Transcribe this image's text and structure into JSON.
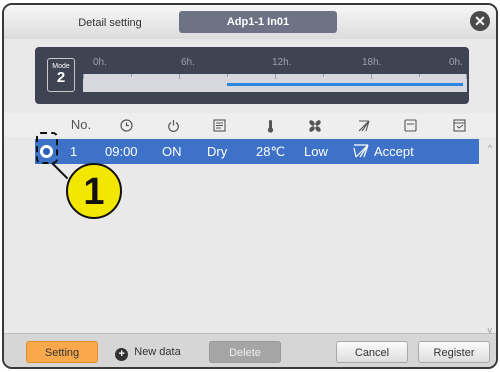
{
  "titlebar": {
    "tab_detail": "Detail setting",
    "tab_unit": "Adp1-1 In01"
  },
  "timeline": {
    "mode_label": "Mode",
    "mode_value": "2",
    "hours": [
      "0h.",
      "6h.",
      "12h.",
      "18h.",
      "0h."
    ],
    "run_start_hour": 9,
    "run_end_hour": 24,
    "run_color": "#2a86e3"
  },
  "headers": {
    "no": "No.",
    "icons": [
      "clock-icon",
      "power-icon",
      "mode-icon",
      "thermometer-icon",
      "fan-icon",
      "louver-icon",
      "filter-icon",
      "permission-icon"
    ]
  },
  "rows": [
    {
      "selected": true,
      "no": "1",
      "time": "09:00",
      "power": "ON",
      "mode": "Dry",
      "temp": "28℃",
      "fan": "Low",
      "louver_icon": "swing-icon",
      "permission": "Accept"
    }
  ],
  "callout": {
    "number": "1"
  },
  "buttons": {
    "setting": "Setting",
    "new_data": "New data",
    "delete": "Delete",
    "cancel": "Cancel",
    "register": "Register"
  },
  "colors": {
    "selected_row": "#3e72c8",
    "setting_button": "#f9a94c",
    "callout": "#f3e600"
  }
}
